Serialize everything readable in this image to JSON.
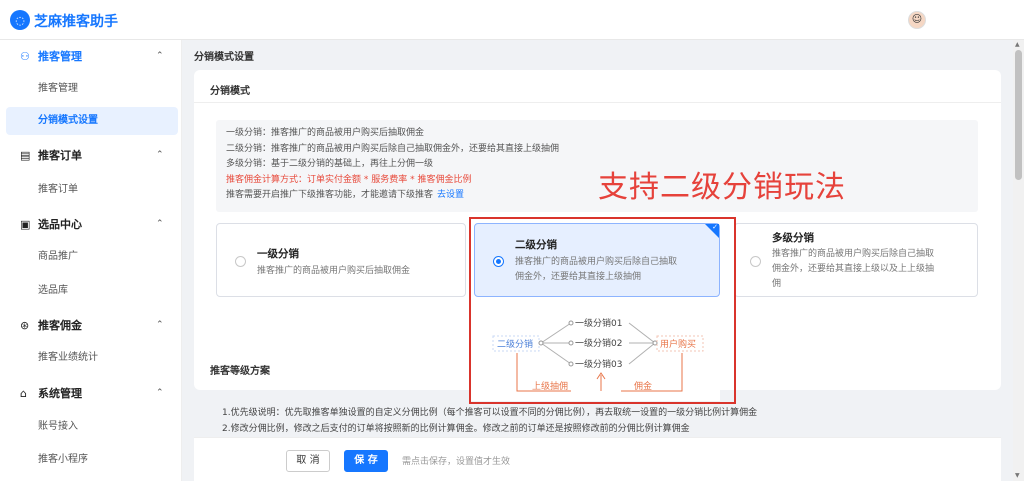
{
  "app": {
    "title": "芝麻推客助手",
    "logo_icon": "chat-bubble-icon"
  },
  "sidebar": {
    "groups": [
      {
        "label": "推客管理",
        "icon": "people-icon",
        "items": [
          "推客管理",
          "分销模式设置"
        ]
      },
      {
        "label": "推客订单",
        "icon": "receipt-icon",
        "items": [
          "推客订单"
        ]
      },
      {
        "label": "选品中心",
        "icon": "box-icon",
        "items": [
          "商品推广",
          "选品库"
        ]
      },
      {
        "label": "推客佣金",
        "icon": "currency-icon",
        "items": [
          "推客业绩统计"
        ]
      },
      {
        "label": "系统管理",
        "icon": "settings-icon",
        "items": [
          "账号接入",
          "推客小程序"
        ]
      }
    ],
    "active_item": "分销模式设置"
  },
  "page": {
    "title": "分销模式设置"
  },
  "mode_card": {
    "title": "分销模式",
    "info": {
      "line1": "一级分销：推客推广的商品被用户购买后抽取佣金",
      "line2": "二级分销：推客推广的商品被用户购买后除自己抽取佣金外，还要给其直接上级抽佣",
      "line3": "多级分销：基于二级分销的基础上，再往上分佣一级",
      "formula": "推客佣金计算方式：订单实付金额 * 服务费率 * 推客佣金比例",
      "note": "推客需要开启推广下级推客功能，才能邀请下级推客",
      "link": "去设置"
    },
    "options": [
      {
        "title": "一级分销",
        "desc": "推客推广的商品被用户购买后抽取佣金",
        "selected": false
      },
      {
        "title": "二级分销",
        "desc1": "推客推广的商品被用户购买后除自己抽取",
        "desc2": "佣金外，还要给其直接上级抽佣",
        "selected": true
      },
      {
        "title": "多级分销",
        "desc1": "推客推广的商品被用户购买后除自己抽取",
        "desc2": "佣金外，还要给其直接上级以及上上级抽",
        "desc3": "佣",
        "selected": false
      }
    ]
  },
  "annotation": {
    "text": "支持二级分销玩法"
  },
  "diagram": {
    "source": "二级分销",
    "nodes": [
      "一级分销01",
      "一级分销02",
      "一级分销03"
    ],
    "target": "用户购买",
    "label_left": "上级抽佣",
    "label_right": "佣金",
    "colors": {
      "blue": "#4a7fd8",
      "orange": "#e8764a",
      "red_border": "#d9342c"
    }
  },
  "level_section": {
    "title": "推客等级方案",
    "rule1": "1.优先级说明：优先取推客单独设置的自定义分佣比例（每个推客可以设置不同的分佣比例），再去取统一设置的一级分销比例计算佣金",
    "rule2": "2.修改分佣比例，修改之后支付的订单将按照新的比例计算佣金。修改之前的订单还是按照修改前的分佣比例计算佣金"
  },
  "footer": {
    "cancel": "取 消",
    "save": "保 存",
    "hint": "需点击保存，设置值才生效"
  }
}
